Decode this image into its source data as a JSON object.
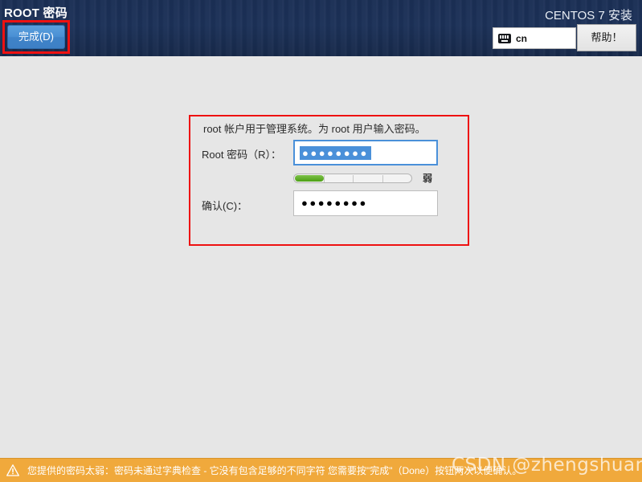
{
  "header": {
    "spine_title": "ROOT 密码",
    "done_button": "完成(D)",
    "product_title": "CENTOS 7 安装",
    "keyboard_icon": "keyboard-icon",
    "keyboard_layout": "cn",
    "help_button": "帮助！"
  },
  "form": {
    "description": "root 帐户用于管理系统。为 root 用户输入密码。",
    "root_password": {
      "label": "Root 密码（R）：",
      "value": "●●●●●●●●",
      "placeholder": "",
      "focused": true,
      "selected": true
    },
    "strength": {
      "label": "弱",
      "percent": 25,
      "segments": 4,
      "fill_color": "#4ca014"
    },
    "confirm_password": {
      "label": "确认(C)：",
      "value": "●●●●●●●●",
      "placeholder": "",
      "focused": false
    }
  },
  "warning": {
    "icon": "warning-triangle-icon",
    "text": "您提供的密码太弱：密码未通过字典检查 - 它没有包含足够的不同字符 您需要按\"完成\"（Done）按钮两次以便确认。"
  },
  "watermark": {
    "text": "CSDN @zhengshuangyue"
  },
  "colors": {
    "header_bg": "#1c3158",
    "body_bg": "#e6e6e6",
    "accent_blue": "#4a90d9",
    "highlight_red": "#ee1111",
    "warning_orange": "#f0a93c",
    "strength_green": "#4ca014"
  }
}
